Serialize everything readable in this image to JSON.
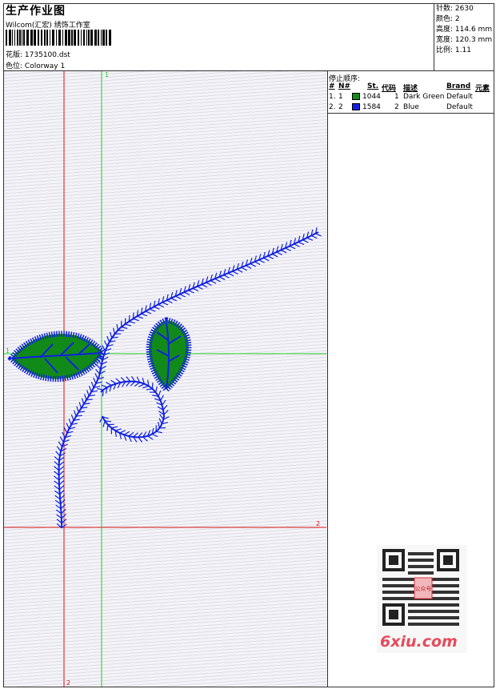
{
  "header": {
    "title": "生产作业图",
    "company": "Wilcom(汇宏) 绣饰工作室",
    "design_label": "花版:",
    "design_value": "1735100.dst",
    "colorway_label": "色位:",
    "colorway_value": "Colorway 1"
  },
  "stats": {
    "stitches_label": "针数:",
    "stitches_value": "2630",
    "colors_label": "颜色:",
    "colors_value": "2",
    "height_label": "高度:",
    "height_value": "114.6 mm",
    "width_label": "宽度:",
    "width_value": "120.3 mm",
    "scale_label": "比例:",
    "scale_value": "1.11"
  },
  "stop_sequence": {
    "title": "停止顺序:",
    "columns": [
      "#",
      "N#",
      "St.",
      "代码",
      "描述",
      "Brand",
      "元素"
    ],
    "rows": [
      {
        "num": "1.",
        "needle": "1",
        "stitches": "1044",
        "code": "1",
        "description": "Dark Green",
        "brand": "Default",
        "color": "#118a1a"
      },
      {
        "num": "2.",
        "needle": "2",
        "stitches": "1584",
        "code": "2",
        "description": "Blue",
        "brand": "Default",
        "color": "#1020e0"
      }
    ]
  },
  "guides": {
    "green_label_top": "1",
    "green_label_left": "1",
    "red_label_right": "2",
    "red_label_bottom": "2",
    "green_color": "#22cc22",
    "red_color": "#dd1111"
  },
  "watermark": {
    "qr_center_text": "公众号",
    "site": "6xiu.com",
    "site_color": "#e44d5c"
  }
}
